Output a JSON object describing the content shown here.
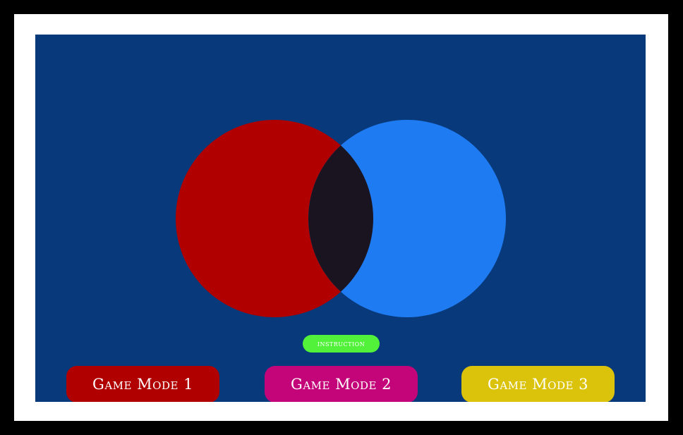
{
  "colors": {
    "outer_background": "#000000",
    "frame": "#ffffff",
    "stage_background": "#08397a",
    "left_circle": "#b00000",
    "right_circle": "#1e7bf2",
    "intersection": "#1a1320",
    "instruction_button": "#52f23a",
    "mode1_button": "#b00000",
    "mode2_button": "#c4057a",
    "mode3_button": "#dcc30b"
  },
  "buttons": {
    "instruction": "instruction",
    "mode1": "Game Mode 1",
    "mode2": "Game Mode 2",
    "mode3": "Game Mode 3"
  }
}
